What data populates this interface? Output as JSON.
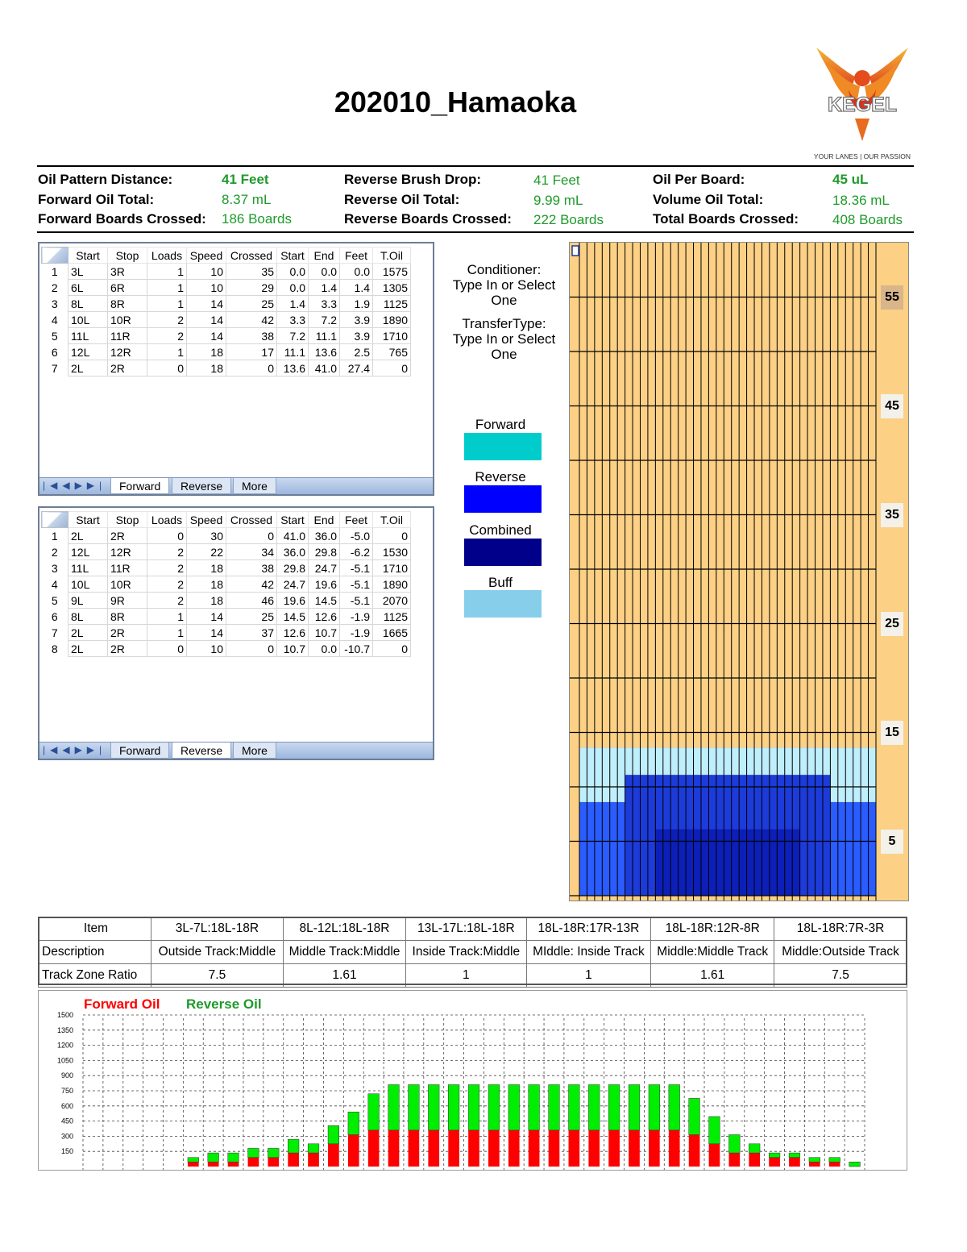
{
  "title": "202010_Hamaoka",
  "logo": {
    "brand": "KEGEL",
    "tagline": "YOUR LANES | OUR PASSION"
  },
  "stats": {
    "oil_pattern_distance": {
      "label": "Oil Pattern Distance:",
      "value": "41 Feet"
    },
    "forward_oil_total": {
      "label": "Forward Oil Total:",
      "value": "8.37 mL"
    },
    "forward_boards_crossed": {
      "label": "Forward Boards Crossed:",
      "value": "186 Boards"
    },
    "reverse_brush_drop": {
      "label": "Reverse Brush Drop:",
      "value": "41 Feet"
    },
    "reverse_oil_total": {
      "label": "Reverse Oil Total:",
      "value": "9.99 mL"
    },
    "reverse_boards_crossed": {
      "label": "Reverse Boards Crossed:",
      "value": "222 Boards"
    },
    "oil_per_board": {
      "label": "Oil Per Board:",
      "value": "45 uL"
    },
    "volume_oil_total": {
      "label": "Volume Oil Total:",
      "value": "18.36 mL"
    },
    "total_boards_crossed": {
      "label": "Total Boards Crossed:",
      "value": "408 Boards"
    }
  },
  "grid_headers": [
    "Start",
    "Stop",
    "Loads",
    "Speed",
    "Crossed",
    "Start",
    "End",
    "Feet",
    "T.Oil"
  ],
  "forward_table": [
    [
      "3L",
      "3R",
      "1",
      "10",
      "35",
      "0.0",
      "0.0",
      "0.0",
      "1575"
    ],
    [
      "6L",
      "6R",
      "1",
      "10",
      "29",
      "0.0",
      "1.4",
      "1.4",
      "1305"
    ],
    [
      "8L",
      "8R",
      "1",
      "14",
      "25",
      "1.4",
      "3.3",
      "1.9",
      "1125"
    ],
    [
      "10L",
      "10R",
      "2",
      "14",
      "42",
      "3.3",
      "7.2",
      "3.9",
      "1890"
    ],
    [
      "11L",
      "11R",
      "2",
      "14",
      "38",
      "7.2",
      "11.1",
      "3.9",
      "1710"
    ],
    [
      "12L",
      "12R",
      "1",
      "18",
      "17",
      "11.1",
      "13.6",
      "2.5",
      "765"
    ],
    [
      "2L",
      "2R",
      "0",
      "18",
      "0",
      "13.6",
      "41.0",
      "27.4",
      "0"
    ]
  ],
  "reverse_table": [
    [
      "2L",
      "2R",
      "0",
      "30",
      "0",
      "41.0",
      "36.0",
      "-5.0",
      "0"
    ],
    [
      "12L",
      "12R",
      "2",
      "22",
      "34",
      "36.0",
      "29.8",
      "-6.2",
      "1530"
    ],
    [
      "11L",
      "11R",
      "2",
      "18",
      "38",
      "29.8",
      "24.7",
      "-5.1",
      "1710"
    ],
    [
      "10L",
      "10R",
      "2",
      "18",
      "42",
      "24.7",
      "19.6",
      "-5.1",
      "1890"
    ],
    [
      "9L",
      "9R",
      "2",
      "18",
      "46",
      "19.6",
      "14.5",
      "-5.1",
      "2070"
    ],
    [
      "8L",
      "8R",
      "1",
      "14",
      "25",
      "14.5",
      "12.6",
      "-1.9",
      "1125"
    ],
    [
      "2L",
      "2R",
      "1",
      "14",
      "37",
      "12.6",
      "10.7",
      "-1.9",
      "1665"
    ],
    [
      "2L",
      "2R",
      "0",
      "10",
      "0",
      "10.7",
      "0.0",
      "-10.7",
      "0"
    ]
  ],
  "tabs": [
    "Forward",
    "Reverse",
    "More"
  ],
  "conditioner": {
    "line1": "Conditioner:",
    "line2": "Type In or Select",
    "line3": "One"
  },
  "transfer": {
    "line1": "TransferType:",
    "line2": "Type In or Select",
    "line3": "One"
  },
  "legend": [
    {
      "label": "Forward",
      "color": "#00cccc"
    },
    {
      "label": "Reverse",
      "color": "#0000ff"
    },
    {
      "label": "Combined",
      "color": "#00008b"
    },
    {
      "label": "Buff",
      "color": "#87ceeb"
    }
  ],
  "colors": {
    "dry": "#fcd085",
    "accent_green": "#1e9a2b",
    "forward_oil": "#ff0000",
    "reverse_oil": "#00ee00"
  },
  "lane_graph": {
    "distance_labels": [
      "55",
      "45",
      "35",
      "25",
      "15",
      "5"
    ]
  },
  "zone_table": {
    "rows": [
      {
        "label": "Item",
        "cells": [
          "3L-7L:18L-18R",
          "8L-12L:18L-18R",
          "13L-17L:18L-18R",
          "18L-18R:17R-13R",
          "18L-18R:12R-8R",
          "18L-18R:7R-3R"
        ]
      },
      {
        "label": "Description",
        "cells": [
          "Outside Track:Middle",
          "Middle Track:Middle",
          "Inside Track:Middle",
          "MIddle: Inside Track",
          "Middle:Middle Track",
          "Middle:Outside Track"
        ]
      },
      {
        "label": "Track Zone Ratio",
        "cells": [
          "7.5",
          "1.61",
          "1",
          "1",
          "1.61",
          "7.5"
        ]
      }
    ]
  },
  "chart_data": {
    "type": "bar",
    "stacked": true,
    "legend": [
      "Forward Oil",
      "Reverse Oil"
    ],
    "ylim": [
      0,
      1500
    ],
    "yticks": [
      "1500",
      "1350",
      "1200",
      "1050",
      "900",
      "750",
      "600",
      "450",
      "300",
      "150"
    ],
    "grid": true,
    "x": [
      1,
      2,
      3,
      4,
      5,
      6,
      7,
      8,
      9,
      10,
      11,
      12,
      13,
      14,
      15,
      16,
      17,
      18,
      19,
      20,
      21,
      22,
      23,
      24,
      25,
      26,
      27,
      28,
      29,
      30,
      31,
      32,
      33,
      34,
      35,
      36,
      37,
      38,
      39
    ],
    "series": [
      {
        "name": "Forward Oil",
        "values": [
          0,
          0,
          0,
          0,
          0,
          45,
          45,
          45,
          90,
          90,
          135,
          135,
          225,
          315,
          360,
          360,
          360,
          360,
          360,
          360,
          360,
          360,
          360,
          360,
          360,
          360,
          360,
          360,
          360,
          360,
          315,
          225,
          135,
          135,
          90,
          90,
          45,
          45,
          0
        ]
      },
      {
        "name": "Reverse Oil",
        "values": [
          0,
          0,
          0,
          0,
          0,
          45,
          90,
          90,
          90,
          90,
          135,
          90,
          180,
          225,
          360,
          450,
          450,
          450,
          450,
          450,
          450,
          450,
          450,
          450,
          450,
          450,
          450,
          450,
          450,
          450,
          360,
          270,
          180,
          90,
          45,
          45,
          45,
          45,
          45
        ]
      }
    ]
  }
}
